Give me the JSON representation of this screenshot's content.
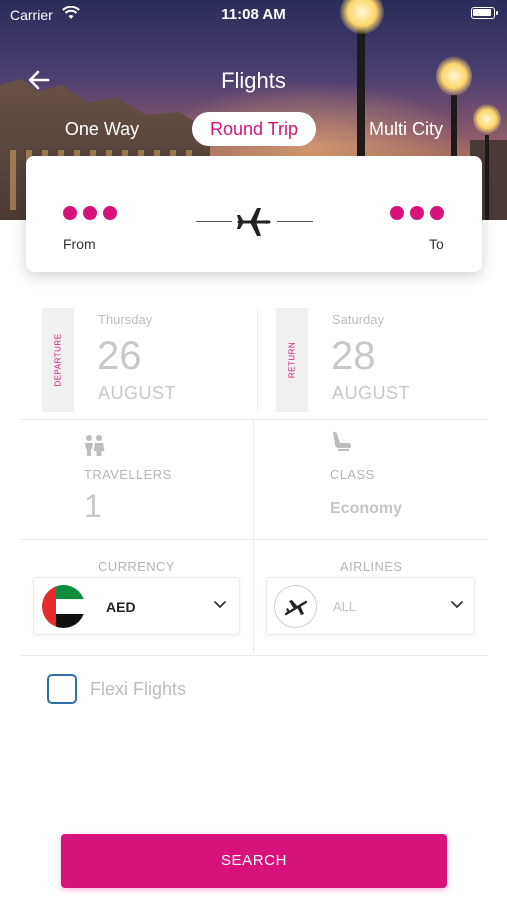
{
  "status_bar": {
    "carrier": "Carrier",
    "time": "11:08 AM"
  },
  "header": {
    "title": "Flights"
  },
  "trip_types": {
    "one_way": "One Way",
    "round_trip": "Round Trip",
    "multi_city": "Multi City",
    "selected": "Round Trip"
  },
  "route": {
    "from_label": "From",
    "to_label": "To"
  },
  "departure": {
    "tag": "DEPARTURE",
    "weekday": "Thursday",
    "day": "26",
    "month": "AUGUST"
  },
  "return": {
    "tag": "RETURN",
    "weekday": "Saturday",
    "day": "28",
    "month": "AUGUST"
  },
  "travellers": {
    "label": "TRAVELLERS",
    "value": "1"
  },
  "cabin_class": {
    "label": "CLASS",
    "value": "Economy"
  },
  "currency": {
    "label": "CURRENCY",
    "value": "AED"
  },
  "airlines": {
    "label": "AIRLINES",
    "value": "ALL"
  },
  "flexi": {
    "label": "Flexi Flights",
    "checked": false
  },
  "search": {
    "label": "SEARCH"
  },
  "colors": {
    "accent": "#d8127b",
    "checkbox": "#2e6fae"
  }
}
